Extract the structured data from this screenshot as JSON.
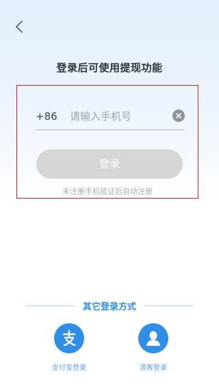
{
  "header": {
    "back_icon": "chevron-left-icon",
    "title": "登录后可使用提现功能"
  },
  "form": {
    "country_code": "+86",
    "phone_placeholder": "请输入手机号",
    "phone_value": "",
    "clear_icon": "clear-icon",
    "login_label": "登录",
    "hint": "未注册手机验证后自动注册"
  },
  "other_login": {
    "title": "其它登录方式",
    "options": [
      {
        "icon": "alipay-icon",
        "label": "支付宝登录"
      },
      {
        "icon": "user-icon",
        "label": "游客登录"
      }
    ]
  },
  "colors": {
    "accent": "#2f8ee5",
    "highlight_border": "#cc2222",
    "button_disabled": "#d6d6d6"
  }
}
